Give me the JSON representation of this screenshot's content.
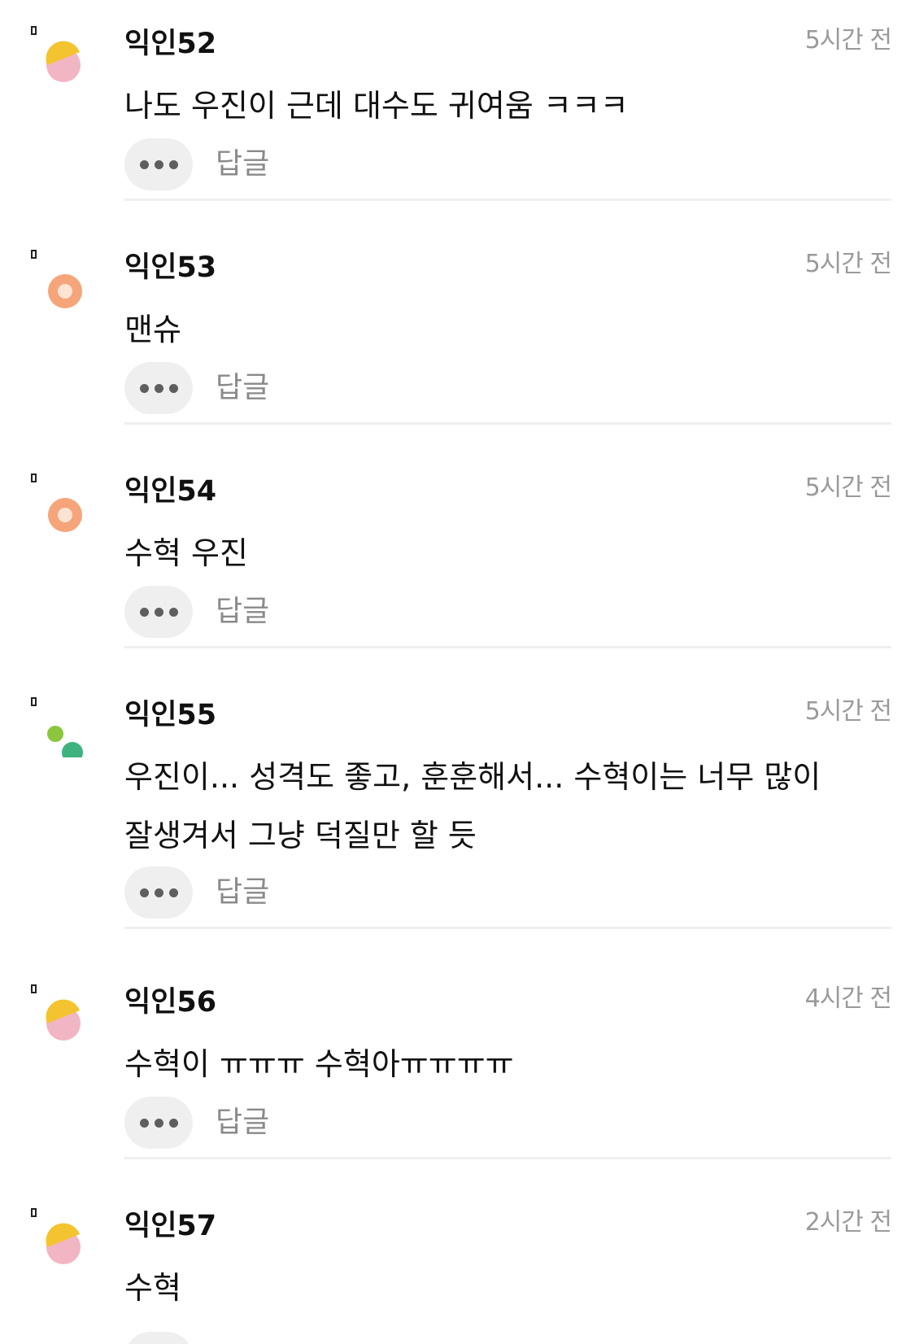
{
  "comments": [
    {
      "nickname": "익인52",
      "time": "5시간 전",
      "text": "나도 우진이 근데 대수도 귀여움 ㅋㅋㅋ",
      "reply_label": "답글",
      "avatar_icon": "half-circle-yellow-pink-icon"
    },
    {
      "nickname": "익인53",
      "time": "5시간 전",
      "text": "맨슈",
      "reply_label": "답글",
      "avatar_icon": "orange-ring-icon"
    },
    {
      "nickname": "익인54",
      "time": "5시간 전",
      "text": "수혁 우진",
      "reply_label": "답글",
      "avatar_icon": "orange-ring-icon"
    },
    {
      "nickname": "익인55",
      "time": "5시간 전",
      "text_line1": "우진이... 성격도 좋고, 훈훈해서... 수혁이는 너무 많이",
      "text_line2": "잘생겨서 그냥 덕질만 할 듯",
      "reply_label": "답글",
      "avatar_icon": "two-green-dots-icon"
    },
    {
      "nickname": "익인56",
      "time": "4시간 전",
      "text": "수혁이 ㅠㅠㅠ 수혁아ㅠㅠㅠㅠ",
      "reply_label": "답글",
      "avatar_icon": "half-circle-yellow-pink-icon"
    },
    {
      "nickname": "익인57",
      "time": "2시간 전",
      "text": "수혁",
      "avatar_icon": "half-circle-yellow-pink-icon"
    }
  ],
  "colors": {
    "nickname": "#111111",
    "time": "#9a9a9a",
    "reply": "#8a8a8a",
    "more_button_bg": "#efefef",
    "divider": "#efefef",
    "avatar_yellow": "#f4c430",
    "avatar_pink": "#f2b5c4",
    "avatar_orange": "#f6a57a",
    "avatar_green_light": "#8cc63f",
    "avatar_green_dark": "#3fb37f"
  }
}
